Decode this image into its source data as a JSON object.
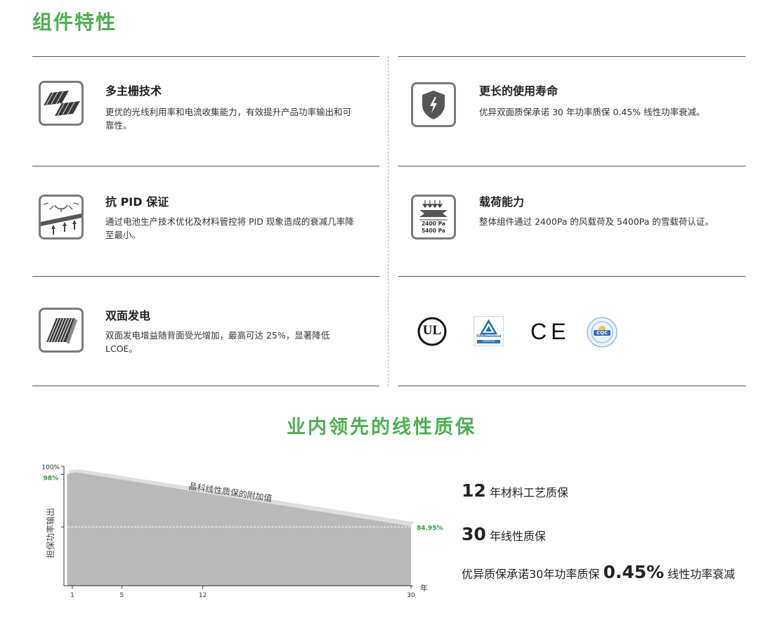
{
  "heading": "组件特性",
  "features": [
    {
      "title": "多主栅技术",
      "desc": "更优的光线利用率和电流收集能力，有效提升产品功率输出和可靠性。",
      "icon": "multi-busbar-icon"
    },
    {
      "title": "更长的使用寿命",
      "desc": "优异双面质保承诺 30 年功率质保 0.45% 线性功率衰减。",
      "icon": "shield-icon"
    },
    {
      "title": "抗 PID 保证",
      "desc": "通过电池生产技术优化及材料管控将 PID 现象造成的衰减几率降至最小。",
      "icon": "anti-pid-icon"
    },
    {
      "title": "载荷能力",
      "desc": "整体组件通过 2400Pa 的风载荷及 5400Pa 的雪载荷认证。",
      "icon": "load-capacity-icon",
      "icon_labels": [
        "2400 Pa",
        "5400 Pa"
      ]
    },
    {
      "title": "双面发电",
      "desc": "双面发电增益随背面受光增加，最高可达 25%，显著降低LCOE。",
      "icon": "bifacial-icon"
    }
  ],
  "certs": {
    "ul": "UL",
    "tuv": "TÜVRheinland",
    "tuv_sub": "CERTIFIED",
    "ce": "CE",
    "cqc": "CQC"
  },
  "warranty_title": "业内领先的线性质保",
  "chart_data": {
    "type": "area",
    "title": "",
    "ylabel": "担保功率输出",
    "xlabel": "年",
    "x_ticks": [
      1,
      5,
      12,
      30
    ],
    "xlim": [
      0,
      30
    ],
    "y_tick_labels": [
      "100%",
      "98%",
      "84.95%"
    ],
    "series": [
      {
        "name": "",
        "x": [
          1,
          30
        ],
        "values": [
          98,
          84.95
        ]
      }
    ],
    "annotations": [
      "晶科线性质保的附加值"
    ],
    "colors": {
      "area": "#b9b9b9",
      "band": "#dedede",
      "highlight": "#2e9b3e"
    }
  },
  "warranty_items": [
    {
      "num": "12",
      "text": "年材料工艺质保"
    },
    {
      "num": "30",
      "text": "年线性质保"
    },
    {
      "pre": "优异质保承诺30年功率质保",
      "num": "0.45%",
      "text": "线性功率衰减"
    }
  ]
}
